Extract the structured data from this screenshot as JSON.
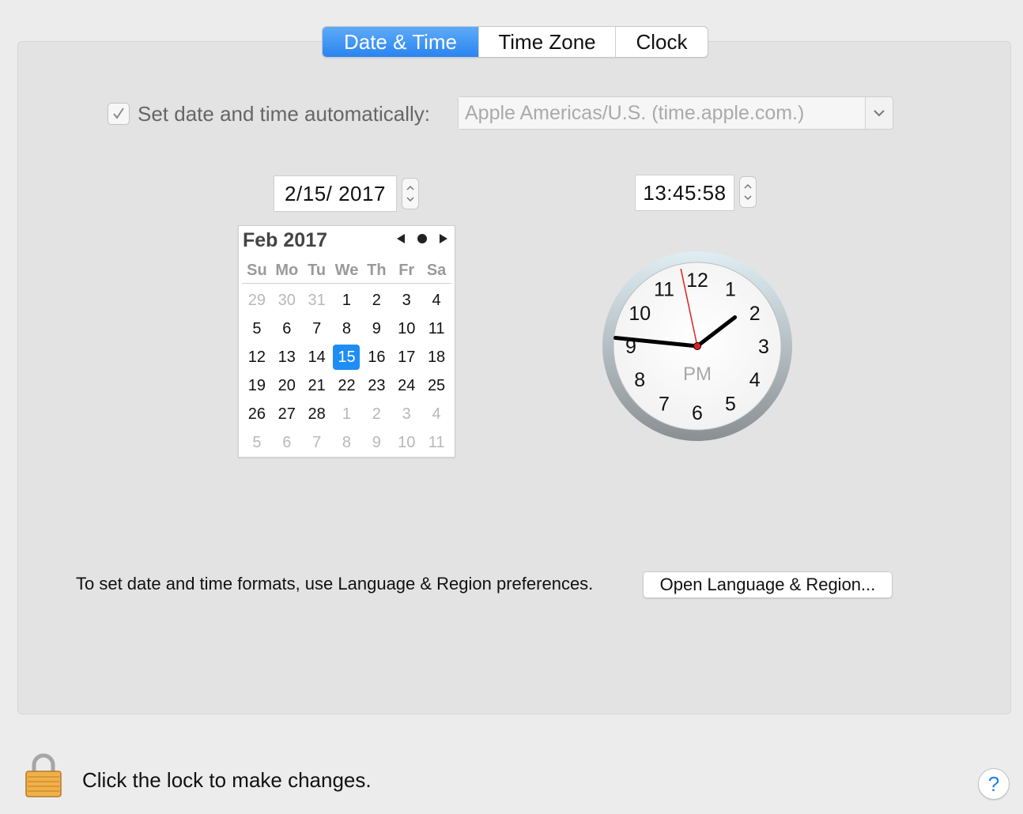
{
  "tabs": [
    {
      "label": "Date & Time",
      "active": true
    },
    {
      "label": "Time Zone",
      "active": false
    },
    {
      "label": "Clock",
      "active": false
    }
  ],
  "auto_time": {
    "checked": true,
    "label": "Set date and time automatically:",
    "server": "Apple Americas/U.S. (time.apple.com.)"
  },
  "date_field": "2/15/ 2017",
  "time_field": "13:45:58",
  "calendar": {
    "month_label": "Feb 2017",
    "weekdays": [
      "Su",
      "Mo",
      "Tu",
      "We",
      "Th",
      "Fr",
      "Sa"
    ],
    "days": [
      {
        "d": "29",
        "other": true
      },
      {
        "d": "30",
        "other": true
      },
      {
        "d": "31",
        "other": true
      },
      {
        "d": "1"
      },
      {
        "d": "2"
      },
      {
        "d": "3"
      },
      {
        "d": "4"
      },
      {
        "d": "5"
      },
      {
        "d": "6"
      },
      {
        "d": "7"
      },
      {
        "d": "8"
      },
      {
        "d": "9"
      },
      {
        "d": "10"
      },
      {
        "d": "11"
      },
      {
        "d": "12"
      },
      {
        "d": "13"
      },
      {
        "d": "14"
      },
      {
        "d": "15",
        "selected": true
      },
      {
        "d": "16"
      },
      {
        "d": "17"
      },
      {
        "d": "18"
      },
      {
        "d": "19"
      },
      {
        "d": "20"
      },
      {
        "d": "21"
      },
      {
        "d": "22"
      },
      {
        "d": "23"
      },
      {
        "d": "24"
      },
      {
        "d": "25"
      },
      {
        "d": "26"
      },
      {
        "d": "27"
      },
      {
        "d": "28"
      },
      {
        "d": "1",
        "other": true
      },
      {
        "d": "2",
        "other": true
      },
      {
        "d": "3",
        "other": true
      },
      {
        "d": "4",
        "other": true
      },
      {
        "d": "5",
        "other": true
      },
      {
        "d": "6",
        "other": true
      },
      {
        "d": "7",
        "other": true
      },
      {
        "d": "8",
        "other": true
      },
      {
        "d": "9",
        "other": true
      },
      {
        "d": "10",
        "other": true
      },
      {
        "d": "11",
        "other": true
      }
    ]
  },
  "clock": {
    "numbers": [
      "12",
      "1",
      "2",
      "3",
      "4",
      "5",
      "6",
      "7",
      "8",
      "9",
      "10",
      "11"
    ],
    "period": "PM",
    "hour": 13,
    "minute": 45,
    "second": 58
  },
  "formats_text": "To set date and time formats, use Language & Region preferences.",
  "open_button": "Open Language & Region...",
  "lock_text": "Click the lock to make changes.",
  "help_label": "?",
  "colors": {
    "accent": "#1e8df5",
    "second_hand": "#e02020"
  }
}
